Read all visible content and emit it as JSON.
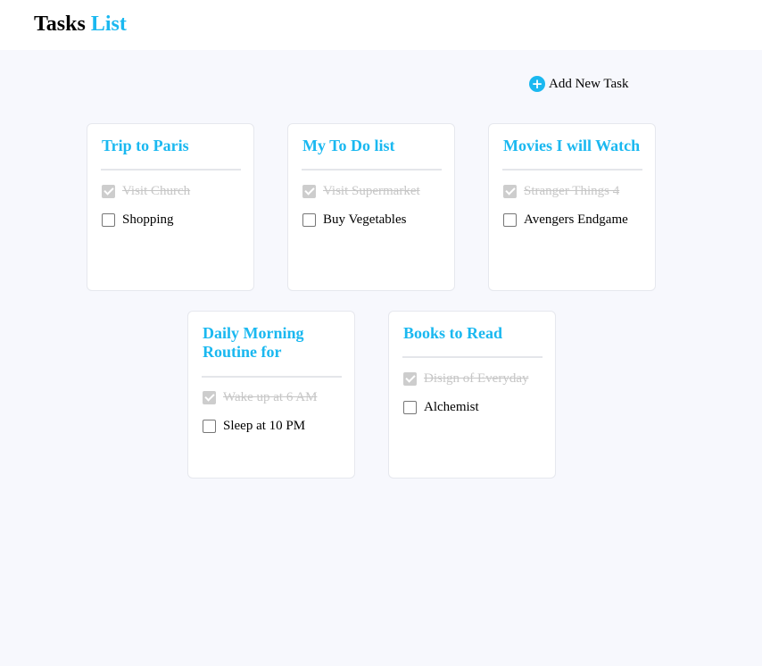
{
  "header": {
    "title_main": "Tasks",
    "title_accent": "List"
  },
  "toolbar": {
    "add_icon": "plus-circle-icon",
    "add_label": "Add New Task"
  },
  "colors": {
    "accent": "#1ab8f0",
    "page_background": "#f7f8fd",
    "done_text": "#c6c6c6"
  },
  "lists": [
    {
      "title": "Trip to Paris",
      "tasks": [
        {
          "label": "Visit Church",
          "done": true
        },
        {
          "label": "Shopping",
          "done": false
        }
      ]
    },
    {
      "title": "My To Do list",
      "tasks": [
        {
          "label": "Visit Supermarket",
          "done": true
        },
        {
          "label": "Buy Vegetables",
          "done": false
        }
      ]
    },
    {
      "title": "Movies I will Watch",
      "tasks": [
        {
          "label": "Stranger Things 4",
          "done": true
        },
        {
          "label": "Avengers Endgame",
          "done": false
        }
      ]
    },
    {
      "title": "Daily Morning Routine for",
      "tasks": [
        {
          "label": "Wake up at 6 AM",
          "done": true
        },
        {
          "label": "Sleep at 10 PM",
          "done": false
        }
      ]
    },
    {
      "title": "Books to Read",
      "tasks": [
        {
          "label": "Disign of Everyday",
          "done": true
        },
        {
          "label": "Alchemist",
          "done": false
        }
      ]
    }
  ]
}
